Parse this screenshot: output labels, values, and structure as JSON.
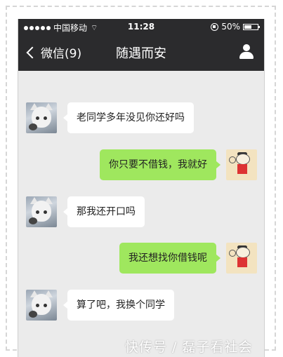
{
  "statusbar": {
    "carrier": "中国移动",
    "time": "11:28",
    "battery": "50%"
  },
  "navbar": {
    "back_label": "微信(9)",
    "title": "随遇而安"
  },
  "messages": [
    {
      "side": "left",
      "text": "老同学多年没见你还好吗"
    },
    {
      "side": "right",
      "text": "你只要不借钱，我就好"
    },
    {
      "side": "left",
      "text": "那我还开口吗"
    },
    {
      "side": "right",
      "text": "我还想找你借钱呢"
    },
    {
      "side": "left",
      "text": "算了吧，我换个同学"
    }
  ],
  "watermark": "快传号 / 磊子看社会",
  "colors": {
    "bar": "#2b2b2d",
    "chat_bg": "#ebebeb",
    "outgoing": "#9fe75e",
    "incoming": "#ffffff"
  }
}
